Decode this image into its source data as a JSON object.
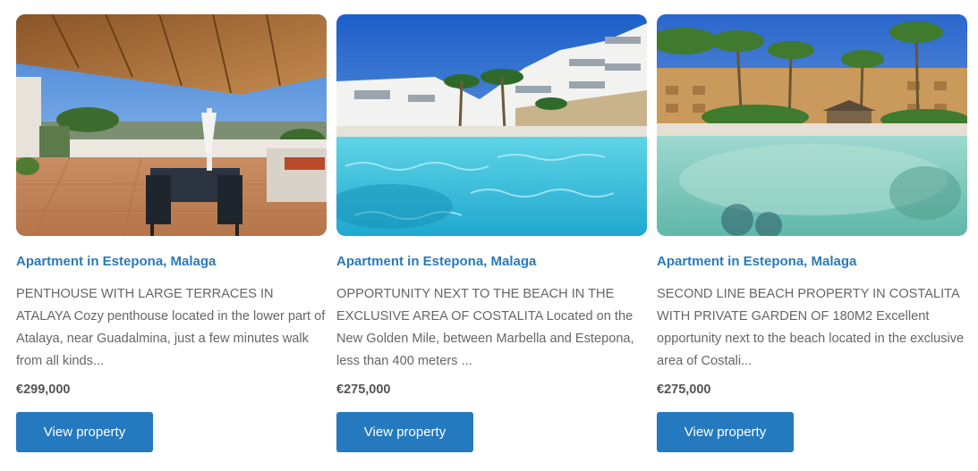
{
  "listings": [
    {
      "title": "Apartment in Estepona, Malaga",
      "description": "PENTHOUSE WITH LARGE TERRACES IN ATALAYA Cozy penthouse located in the lower part of Atalaya, near Guadalmina, just a few minutes walk from all kinds...",
      "price": "€299,000",
      "button_label": "View property"
    },
    {
      "title": "Apartment in Estepona, Malaga",
      "description": "OPPORTUNITY NEXT TO THE BEACH IN THE EXCLUSIVE AREA OF COSTALITA Located on the New Golden Mile, between Marbella and Estepona, less than 400 meters ...",
      "price": "€275,000",
      "button_label": "View property"
    },
    {
      "title": "Apartment in Estepona, Malaga",
      "description": "SECOND LINE BEACH PROPERTY IN COSTALITA WITH PRIVATE GARDEN OF 180M2 Excellent opportunity next to the beach located in the exclusive area of Costali...",
      "price": "€275,000",
      "button_label": "View property"
    }
  ],
  "colors": {
    "title": "#2b7ab8",
    "button": "#2479bf",
    "text": "#666666"
  }
}
